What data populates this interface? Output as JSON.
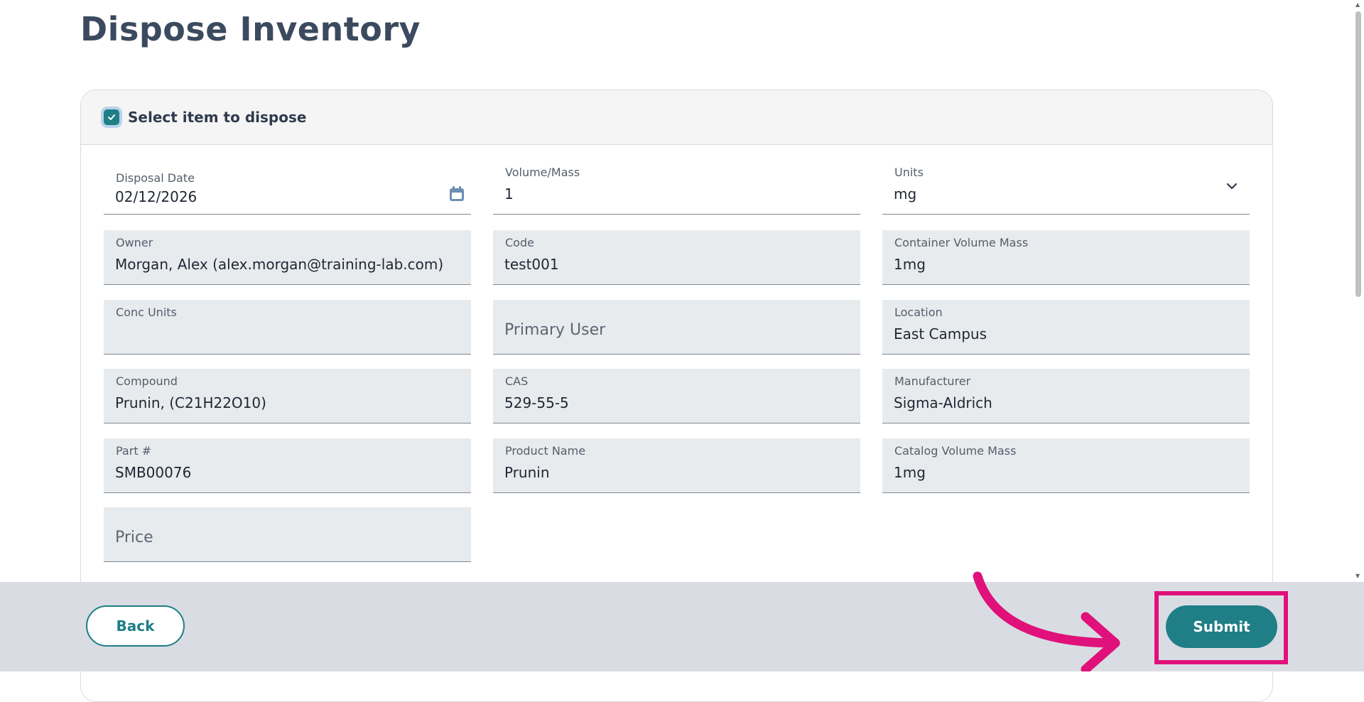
{
  "page": {
    "title": "Dispose Inventory"
  },
  "header": {
    "label": "Select item to dispose",
    "checked": true
  },
  "fields": {
    "disposal_date": {
      "label": "Disposal Date",
      "value": "02/12/2026",
      "icon": "calendar-icon"
    },
    "volume_mass": {
      "label": "Volume/Mass",
      "value": "1"
    },
    "units": {
      "label": "Units",
      "value": "mg",
      "icon": "chevron-down-icon"
    },
    "owner": {
      "label": "Owner",
      "value": "Morgan, Alex (alex.morgan@training-lab.com)"
    },
    "code": {
      "label": "Code",
      "value": "test001"
    },
    "container_volume_mass": {
      "label": "Container Volume Mass",
      "value": "1mg"
    },
    "conc_units": {
      "label": "Conc Units",
      "value": ""
    },
    "primary_user": {
      "placeholder": "Primary User"
    },
    "location": {
      "label": "Location",
      "value": "East Campus"
    },
    "compound": {
      "label": "Compound",
      "value": "Prunin, (C21H22O10)"
    },
    "cas": {
      "label": "CAS",
      "value": "529-55-5"
    },
    "manufacturer": {
      "label": "Manufacturer",
      "value": "Sigma-Aldrich"
    },
    "part_number": {
      "label": "Part #",
      "value": "SMB00076"
    },
    "product_name": {
      "label": "Product Name",
      "value": "Prunin"
    },
    "catalog_volume_mass": {
      "label": "Catalog Volume Mass",
      "value": "1mg"
    },
    "price": {
      "placeholder": "Price"
    }
  },
  "footer": {
    "back_label": "Back",
    "submit_label": "Submit"
  },
  "colors": {
    "accent": "#1f7e86",
    "highlight": "#e0117a",
    "footer_bg": "#d9dde3"
  }
}
